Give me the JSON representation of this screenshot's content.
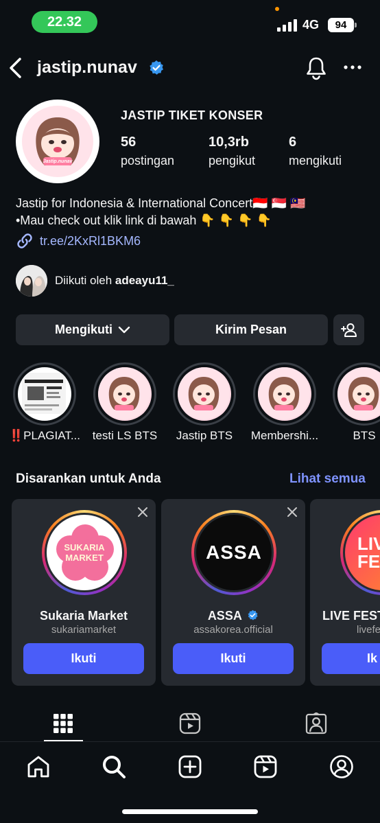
{
  "status_bar": {
    "time": "22.32",
    "network": "4G",
    "battery": "94"
  },
  "header": {
    "username": "jastip.nunav"
  },
  "profile": {
    "display_name": "JASTIP TIKET KONSER",
    "avatar_text": "Jastip.nunav",
    "stats": [
      {
        "value": "56",
        "label": "postingan"
      },
      {
        "value": "10,3rb",
        "label": "pengikut"
      },
      {
        "value": "6",
        "label": "mengikuti"
      }
    ],
    "bio_line1": "Jastip for Indonesia & International Concert🇮🇩 🇸🇬 🇲🇾",
    "bio_line2": "•Mau check out klik link di bawah 👇 👇 👇 👇",
    "link": "tr.ee/2KxRl1BKM6",
    "followed_by_prefix": "Diikuti oleh ",
    "followed_by_user": "adeayu11_"
  },
  "actions": {
    "following": "Mengikuti",
    "message": "Kirim Pesan"
  },
  "highlights": [
    {
      "label": "‼️PLAGIAT..."
    },
    {
      "label": "testi LS BTS"
    },
    {
      "label": "Jastip BTS"
    },
    {
      "label": "Membershi..."
    },
    {
      "label": "BTS"
    }
  ],
  "suggestions": {
    "title": "Disarankan untuk Anda",
    "see_all": "Lihat semua",
    "cards": [
      {
        "name": "Sukaria Market",
        "handle": "sukariamarket",
        "logo_text": "SUKARIA MARKET",
        "button": "Ikuti"
      },
      {
        "name": "ASSA",
        "handle": "assakorea.official",
        "logo_text": "ASSA",
        "button": "Ikuti"
      },
      {
        "name": "LIVE FEST",
        "handle": "livefe",
        "logo_text": "LIVE FE",
        "button": "Ik"
      }
    ]
  },
  "colors": {
    "background": "#0c1014",
    "button": "#262a30",
    "accent": "#4a5df9",
    "link": "#a5b8ff",
    "see_all": "#7f93ff",
    "verified": "#3897f0"
  }
}
